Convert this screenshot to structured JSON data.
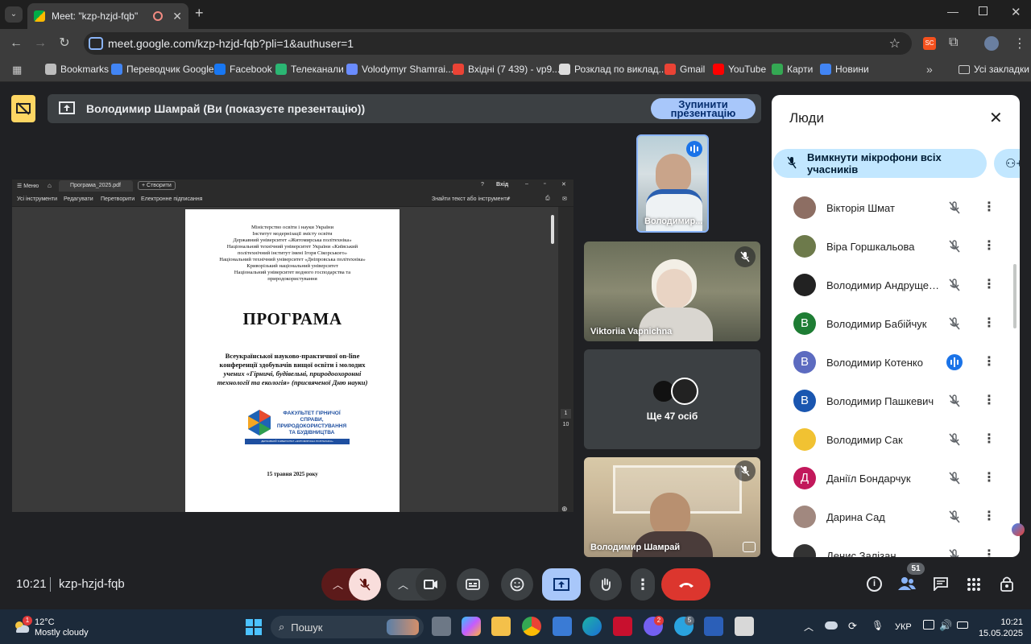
{
  "browser": {
    "tab_title": "Meet: \"kzp-hzjd-fqb\"",
    "url": "meet.google.com/kzp-hzjd-fqb?pli=1&authuser=1",
    "bookmarks": [
      {
        "label": "Bookmarks",
        "icon": "star-icon",
        "color": "#bdbdbd"
      },
      {
        "label": "Переводчик Google",
        "icon": "translate-icon",
        "color": "#4285f4"
      },
      {
        "label": "Facebook",
        "icon": "facebook-icon",
        "color": "#1877f2"
      },
      {
        "label": "Телеканали",
        "icon": "tv-icon",
        "color": "#2bb673"
      },
      {
        "label": "Volodymyr Shamrai...",
        "icon": "diamond-icon",
        "color": "#6a8cff"
      },
      {
        "label": "Вхідні (7 439) - vp9...",
        "icon": "gmail-icon",
        "color": "#ea4335"
      },
      {
        "label": "Розклад по виклад...",
        "icon": "globe-icon",
        "color": "#dddddd"
      },
      {
        "label": "Gmail",
        "icon": "gmail-icon",
        "color": "#ea4335"
      },
      {
        "label": "YouTube",
        "icon": "youtube-icon",
        "color": "#ff0000"
      },
      {
        "label": "Карти",
        "icon": "maps-icon",
        "color": "#34a853"
      },
      {
        "label": "Новини",
        "icon": "news-icon",
        "color": "#4285f4"
      }
    ],
    "all_bookmarks": "Усі закладки"
  },
  "meet": {
    "presenting_text": "Володимир Шамрай (Ви (показуєте презентацію))",
    "stop_button": "Зупинити презентацію",
    "time": "10:21",
    "code": "kzp-hzjd-fqb",
    "people_count": "51"
  },
  "pdf": {
    "menu": "Меню",
    "filename": "Програма_2025.pdf",
    "create": "Створити",
    "signin": "Вхід",
    "tools": [
      "Усі інструменти",
      "Редагувати",
      "Перетворити",
      "Електронне підписання"
    ],
    "search": "Знайти текст або інструменти",
    "header_lines": [
      "Міністерство освіти і науки України",
      "Інститут модернізації змісту освіти",
      "Державний університет «Житомирська політехніка»",
      "Національний технічний університет України «Київський",
      "політехнічний інститут імені Ігоря Сікорського»",
      "Національний технічний університет «Дніпровська політехніка»",
      "Криворізький національний університет",
      "Національний університет водного господарства та",
      "природокористування"
    ],
    "title": "ПРОГРАМА",
    "subtitle_lines": [
      "Всеукраїнської науково-практичної on-line",
      "конференції здобувачів вищої освіти і молодих",
      "учених «Гірничі, будівельні, природоохоронні",
      "технології та екологія» (присвяченої Дню науки)"
    ],
    "logo_text": "ФАКУЛЬТЕТ ГІРНИЧОЇ СПРАВИ, ПРИРОДОКОРИСТУВАННЯ ТА БУДІВНИЦТВА",
    "logo_sub": "ДЕРЖАВНИЙ УНІВЕРСИТЕТ «ЖИТОМИРСЬКА ПОЛІТЕХНІКА»",
    "date": "15 травня 2025 року",
    "page_current": "1",
    "page_total": "10"
  },
  "tiles": {
    "self_name": "Володимир...",
    "t1_name": "Viktoriia Vapnichna",
    "more_label": "Ще 47 осіб",
    "t3_name": "Володимир Шамрай"
  },
  "people_panel": {
    "title": "Люди",
    "mute_all": "Вимкнути мікрофони всіх учасників",
    "people": [
      {
        "name": "Вікторія Шмат",
        "initial": "",
        "color": "#8d6e63",
        "speaking": false
      },
      {
        "name": "Віра Горшкальова",
        "initial": "",
        "color": "#6d7a4b",
        "speaking": false
      },
      {
        "name": "Володимир Андрущенко",
        "initial": "",
        "color": "#222222",
        "speaking": false
      },
      {
        "name": "Володимир Бабійчук",
        "initial": "В",
        "color": "#1e7d34",
        "speaking": false
      },
      {
        "name": "Володимир Котенко",
        "initial": "В",
        "color": "#5c6bc0",
        "speaking": true
      },
      {
        "name": "Володимир Пашкевич",
        "initial": "В",
        "color": "#1a56b0",
        "speaking": false
      },
      {
        "name": "Володимир Сак",
        "initial": "",
        "color": "#f1c232",
        "speaking": false
      },
      {
        "name": "Даніїл Бондарчук",
        "initial": "Д",
        "color": "#c2185b",
        "speaking": false
      },
      {
        "name": "Дарина Сад",
        "initial": "",
        "color": "#a1887f",
        "speaking": false
      },
      {
        "name": "Денис Залізан",
        "initial": "",
        "color": "#333333",
        "speaking": false
      }
    ]
  },
  "taskbar": {
    "weather_temp": "12°C",
    "weather_desc": "Mostly cloudy",
    "search": "Пошук",
    "lang": "УКР",
    "time": "10:21",
    "date": "15.05.2025",
    "weather_badge": "1",
    "viber_badge": "2",
    "telegram_badge": "5"
  }
}
